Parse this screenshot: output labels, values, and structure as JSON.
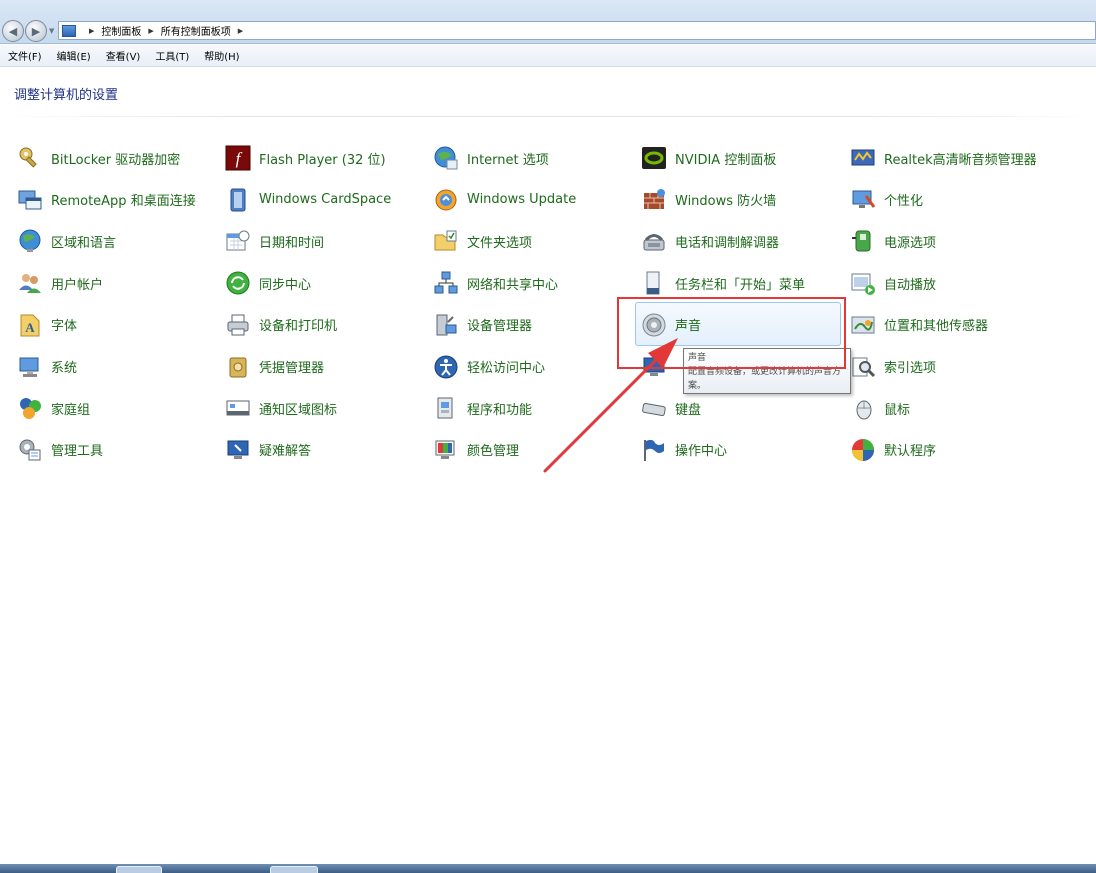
{
  "address": {
    "crumbs": [
      "控制面板",
      "所有控制面板项"
    ]
  },
  "menu": [
    "文件(F)",
    "编辑(E)",
    "查看(V)",
    "工具(T)",
    "帮助(H)"
  ],
  "header": {
    "title": "调整计算机的设置"
  },
  "items": [
    {
      "label": "BitLocker 驱动器加密",
      "icon": "bitlocker-key-icon"
    },
    {
      "label": "Flash Player (32 位)",
      "icon": "flash-icon"
    },
    {
      "label": "Internet 选项",
      "icon": "internet-globe-icon"
    },
    {
      "label": "NVIDIA 控制面板",
      "icon": "nvidia-icon"
    },
    {
      "label": "Realtek高清晰音频管理器",
      "icon": "realtek-audio-icon"
    },
    {
      "label": "RemoteApp 和桌面连接",
      "icon": "remoteapp-icon"
    },
    {
      "label": "Windows CardSpace",
      "icon": "cardspace-icon"
    },
    {
      "label": "Windows Update",
      "icon": "windows-update-icon"
    },
    {
      "label": "Windows 防火墙",
      "icon": "firewall-icon"
    },
    {
      "label": "个性化",
      "icon": "personalization-icon"
    },
    {
      "label": "区域和语言",
      "icon": "region-globe-icon"
    },
    {
      "label": "日期和时间",
      "icon": "calendar-clock-icon"
    },
    {
      "label": "文件夹选项",
      "icon": "folder-options-icon"
    },
    {
      "label": "电话和调制解调器",
      "icon": "phone-modem-icon"
    },
    {
      "label": "电源选项",
      "icon": "power-icon"
    },
    {
      "label": "用户帐户",
      "icon": "user-accounts-icon"
    },
    {
      "label": "同步中心",
      "icon": "sync-center-icon"
    },
    {
      "label": "网络和共享中心",
      "icon": "network-icon"
    },
    {
      "label": "任务栏和「开始」菜单",
      "icon": "taskbar-icon"
    },
    {
      "label": "自动播放",
      "icon": "autoplay-icon"
    },
    {
      "label": "字体",
      "icon": "fonts-icon"
    },
    {
      "label": "设备和打印机",
      "icon": "printer-icon"
    },
    {
      "label": "设备管理器",
      "icon": "device-manager-icon"
    },
    {
      "label": "声音",
      "icon": "speaker-icon"
    },
    {
      "label": "位置和其他传感器",
      "icon": "sensor-icon"
    },
    {
      "label": "系统",
      "icon": "system-computer-icon"
    },
    {
      "label": "凭据管理器",
      "icon": "credential-vault-icon"
    },
    {
      "label": "轻松访问中心",
      "icon": "ease-of-access-icon"
    },
    {
      "label": "",
      "icon": "display-icon"
    },
    {
      "label": "索引选项",
      "icon": "indexing-icon"
    },
    {
      "label": "家庭组",
      "icon": "homegroup-icon"
    },
    {
      "label": "通知区域图标",
      "icon": "notification-icon"
    },
    {
      "label": "程序和功能",
      "icon": "programs-icon"
    },
    {
      "label": "键盘",
      "icon": "keyboard-icon"
    },
    {
      "label": "鼠标",
      "icon": "mouse-icon"
    },
    {
      "label": "管理工具",
      "icon": "admin-tools-icon"
    },
    {
      "label": "疑难解答",
      "icon": "troubleshoot-icon"
    },
    {
      "label": "颜色管理",
      "icon": "color-management-icon"
    },
    {
      "label": "操作中心",
      "icon": "action-center-flag-icon"
    },
    {
      "label": "默认程序",
      "icon": "default-programs-icon"
    }
  ],
  "tooltip": {
    "title": "声音",
    "description": "配置音频设备，或更改计算机的声音方案。"
  },
  "colors": {
    "link_green": "#1e6a1b",
    "header_blue": "#1e3287",
    "annotation_red": "#e33838"
  }
}
